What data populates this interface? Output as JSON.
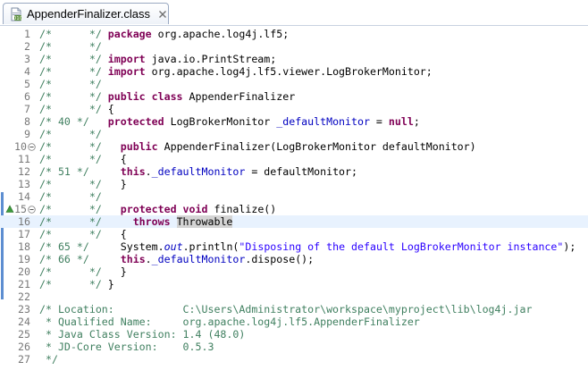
{
  "tab": {
    "title": "AppenderFinalizer.class",
    "icon": "java-class-file-icon",
    "close_icon": "close-icon"
  },
  "colors": {
    "comment": "#3f7f5f",
    "keyword": "#7f0055",
    "field": "#0000c0",
    "string": "#2a00ff",
    "line_number": "#787878",
    "current_line": "#e8f2fe",
    "occurrence_highlight": "#d4d4d4",
    "ruler_mark": "#5d8ed1"
  },
  "editor": {
    "current_line": 16,
    "lines": [
      {
        "n": "1",
        "tokens": [
          [
            "cm",
            "/*      */ "
          ],
          [
            "kw",
            "package"
          ],
          [
            "pl",
            " org.apache.log4j.lf5;"
          ]
        ]
      },
      {
        "n": "2",
        "tokens": [
          [
            "cm",
            "/*      */"
          ]
        ]
      },
      {
        "n": "3",
        "tokens": [
          [
            "cm",
            "/*      */ "
          ],
          [
            "kw",
            "import"
          ],
          [
            "pl",
            " java.io.PrintStream;"
          ]
        ]
      },
      {
        "n": "4",
        "tokens": [
          [
            "cm",
            "/*      */ "
          ],
          [
            "kw",
            "import"
          ],
          [
            "pl",
            " org.apache.log4j.lf5.viewer.LogBrokerMonitor;"
          ]
        ]
      },
      {
        "n": "5",
        "tokens": [
          [
            "cm",
            "/*      */"
          ]
        ]
      },
      {
        "n": "6",
        "tokens": [
          [
            "cm",
            "/*      */ "
          ],
          [
            "kw",
            "public class"
          ],
          [
            "pl",
            " AppenderFinalizer"
          ]
        ]
      },
      {
        "n": "7",
        "tokens": [
          [
            "cm",
            "/*      */ "
          ],
          [
            "pl",
            "{"
          ]
        ]
      },
      {
        "n": "8",
        "tokens": [
          [
            "cm",
            "/* 40 */   "
          ],
          [
            "kw",
            "protected"
          ],
          [
            "pl",
            " LogBrokerMonitor "
          ],
          [
            "fld",
            "_defaultMonitor"
          ],
          [
            "pl",
            " = "
          ],
          [
            "kw",
            "null"
          ],
          [
            "pl",
            ";"
          ]
        ]
      },
      {
        "n": "9",
        "tokens": [
          [
            "cm",
            "/*      */"
          ]
        ]
      },
      {
        "n": "10",
        "fold": true,
        "tokens": [
          [
            "cm",
            "/*      */   "
          ],
          [
            "kw",
            "public"
          ],
          [
            "pl",
            " AppenderFinalizer(LogBrokerMonitor defaultMonitor)"
          ]
        ]
      },
      {
        "n": "11",
        "tokens": [
          [
            "cm",
            "/*      */   "
          ],
          [
            "pl",
            "{"
          ]
        ]
      },
      {
        "n": "12",
        "tokens": [
          [
            "cm",
            "/* 51 */     "
          ],
          [
            "kw",
            "this"
          ],
          [
            "pl",
            "."
          ],
          [
            "fld",
            "_defaultMonitor"
          ],
          [
            "pl",
            " = defaultMonitor;"
          ]
        ]
      },
      {
        "n": "13",
        "tokens": [
          [
            "cm",
            "/*      */   "
          ],
          [
            "pl",
            "}"
          ]
        ]
      },
      {
        "n": "14",
        "tokens": [
          [
            "cm",
            "/*      */"
          ]
        ]
      },
      {
        "n": "15",
        "fold": true,
        "warn": true,
        "tokens": [
          [
            "cm",
            "/*      */   "
          ],
          [
            "kw",
            "protected void"
          ],
          [
            "pl",
            " finalize()"
          ]
        ]
      },
      {
        "n": "16",
        "tokens": [
          [
            "cm",
            "/*      */     "
          ],
          [
            "kw",
            "throws"
          ],
          [
            "pl",
            " "
          ],
          [
            "hl",
            "Throwable"
          ]
        ]
      },
      {
        "n": "17",
        "tokens": [
          [
            "cm",
            "/*      */   "
          ],
          [
            "pl",
            "{"
          ]
        ]
      },
      {
        "n": "18",
        "tokens": [
          [
            "cm",
            "/* 65 */     "
          ],
          [
            "pl",
            "System."
          ],
          [
            "sfld",
            "out"
          ],
          [
            "pl",
            ".println("
          ],
          [
            "str",
            "\"Disposing of the default LogBrokerMonitor instance\""
          ],
          [
            "pl",
            ");"
          ]
        ]
      },
      {
        "n": "19",
        "tokens": [
          [
            "cm",
            "/* 66 */     "
          ],
          [
            "kw",
            "this"
          ],
          [
            "pl",
            "."
          ],
          [
            "fld",
            "_defaultMonitor"
          ],
          [
            "pl",
            ".dispose();"
          ]
        ]
      },
      {
        "n": "20",
        "tokens": [
          [
            "cm",
            "/*      */   "
          ],
          [
            "pl",
            "}"
          ]
        ]
      },
      {
        "n": "21",
        "tokens": [
          [
            "cm",
            "/*      */ "
          ],
          [
            "pl",
            "}"
          ]
        ]
      },
      {
        "n": "22",
        "tokens": []
      },
      {
        "n": "23",
        "tokens": [
          [
            "cm",
            "/* Location:           C:\\Users\\Administrator\\workspace\\myproject\\lib\\log4j.jar"
          ]
        ]
      },
      {
        "n": "24",
        "tokens": [
          [
            "cm",
            " * Qualified Name:     org.apache.log4j.lf5.AppenderFinalizer"
          ]
        ]
      },
      {
        "n": "25",
        "tokens": [
          [
            "cm",
            " * Java Class Version: 1.4 (48.0)"
          ]
        ]
      },
      {
        "n": "26",
        "tokens": [
          [
            "cm",
            " * JD-Core Version:    0.5.3"
          ]
        ]
      },
      {
        "n": "27",
        "tokens": [
          [
            "cm",
            " */"
          ]
        ]
      }
    ]
  }
}
